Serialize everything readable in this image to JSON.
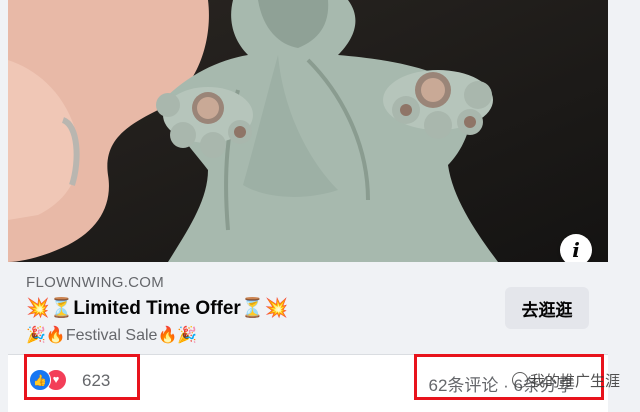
{
  "post": {
    "link": {
      "domain": "FLOWNWING.COM",
      "headline": "💥⏳Limited Time Offer⏳💥",
      "subline": "🎉🔥Festival Sale🔥🎉",
      "cta_label": "去逛逛"
    },
    "info_icon_glyph": "i",
    "reactions": {
      "icons": [
        "like-icon",
        "love-icon"
      ],
      "count": "623",
      "comments_shares": "62条评论 · 6条分享"
    }
  },
  "watermark": {
    "text": "我的推广生涯"
  },
  "colors": {
    "like_blue": "#1877f2",
    "love_red": "#f33e58",
    "highlight_red": "#e8131c",
    "card_bg": "#f0f2f5"
  }
}
